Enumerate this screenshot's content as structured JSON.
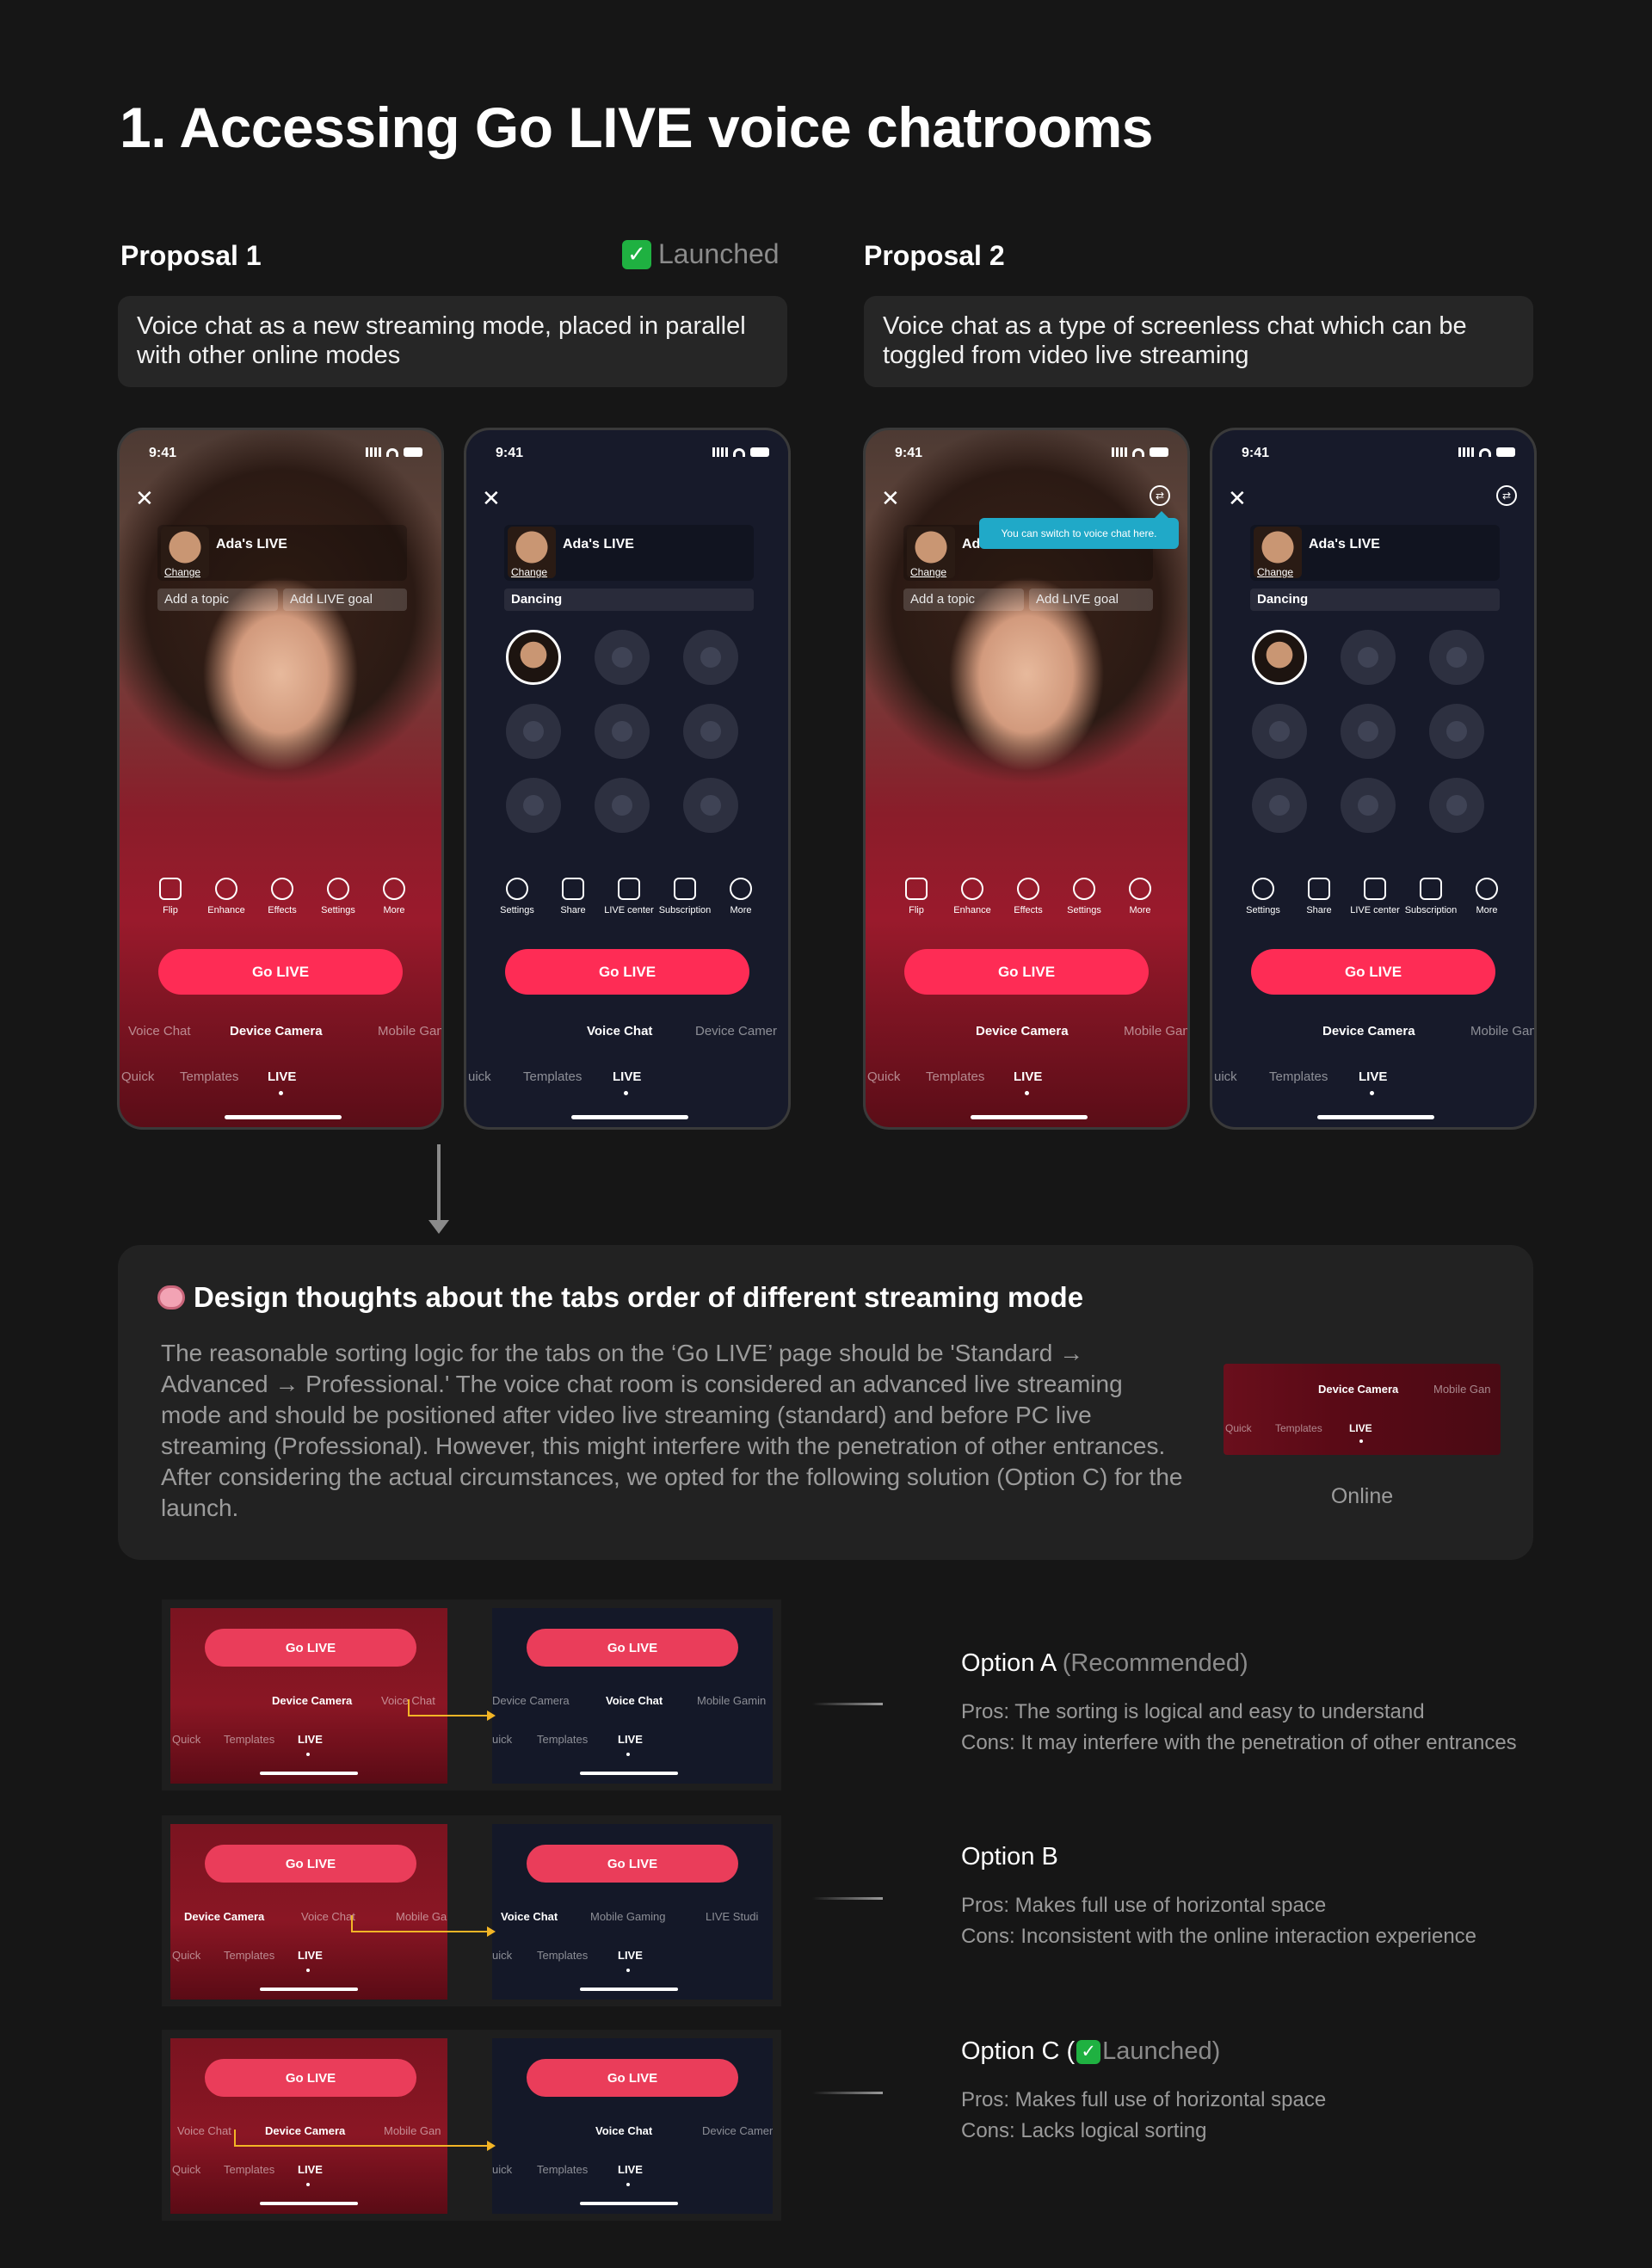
{
  "page_title": "1. Accessing Go LIVE voice chatrooms",
  "proposals": [
    {
      "title": "Proposal 1",
      "status": "Launched",
      "description": "Voice chat as a new streaming mode, placed in parallel with other online modes"
    },
    {
      "title": "Proposal 2",
      "description": "Voice chat as a type of screenless chat which can be toggled from video live streaming"
    }
  ],
  "phone": {
    "time": "9:41",
    "live_name": "Ada's LIVE",
    "change": "Change",
    "add_topic": "Add a topic",
    "add_goal": "Add LIVE goal",
    "topic_dancing": "Dancing",
    "go_live": "Go LIVE",
    "tooltip": "You can switch to voice chat here.",
    "video_tools": [
      "Flip",
      "Enhance",
      "Effects",
      "Settings",
      "More"
    ],
    "voice_tools": [
      "Settings",
      "Share",
      "LIVE center",
      "Subscription",
      "More"
    ],
    "modes": {
      "voice_chat": "Voice Chat",
      "device_camera": "Device Camera",
      "device_camera_cut": "Device Camer",
      "mobile_gaming_cut": "Mobile Gan"
    },
    "tabs": {
      "quick": "Quick",
      "quick_cut": "uick",
      "templates": "Templates",
      "live": "LIVE"
    }
  },
  "thoughts": {
    "title": "Design thoughts about the tabs order of different streaming mode",
    "body": "The reasonable sorting logic for the tabs on the ‘Go LIVE’ page should be 'Standard → Advanced → Professional.' The voice chat room is considered an advanced live streaming mode and should be positioned after video live streaming (standard) and before PC live streaming (Professional). However, this might interfere with the penetration of other entrances. After considering the actual circumstances, we opted for the following solution (Option C) for the launch.",
    "thumb_modes": {
      "device_camera": "Device Camera",
      "mobile_gaming": "Mobile Gan"
    },
    "thumb_tabs": {
      "quick": "Quick",
      "templates": "Templates",
      "live": "LIVE"
    },
    "online_label": "Online"
  },
  "options": [
    {
      "name": "Option A",
      "note": "(Recommended)",
      "pros": "Pros: The sorting is logical and easy to understand",
      "cons": "Cons: It may interfere with the penetration of other entrances",
      "left_modes": [
        "Device Camera",
        "Voice Chat"
      ],
      "right_modes": [
        "Device Camera",
        "Voice Chat",
        "Mobile Gamin"
      ]
    },
    {
      "name": "Option B",
      "note": "",
      "pros": "Pros: Makes full use of horizontal space",
      "cons": "Cons: Inconsistent with the online interaction experience",
      "left_modes": [
        "Device Camera",
        "Voice Chat",
        "Mobile Ga"
      ],
      "right_modes": [
        "Voice Chat",
        "Mobile Gaming",
        "LIVE Studi"
      ]
    },
    {
      "name": "Option C (",
      "note": "Launched)",
      "pros": "Pros: Makes full use of horizontal space",
      "cons": "Cons: Lacks logical sorting",
      "left_modes": [
        "Voice Chat",
        "Device Camera",
        "Mobile Gan"
      ],
      "right_modes": [
        "Voice Chat",
        "Device Camer"
      ]
    }
  ],
  "option_tabs": {
    "quick": "Quick",
    "quick_cut": "uick",
    "templates": "Templates",
    "live": "LIVE",
    "go_live": "Go LIVE"
  },
  "colors": {
    "background": "#161616",
    "card": "#262626",
    "accent": "#fe2c55",
    "arrow": "#f3b526",
    "check": "#1fb141"
  }
}
